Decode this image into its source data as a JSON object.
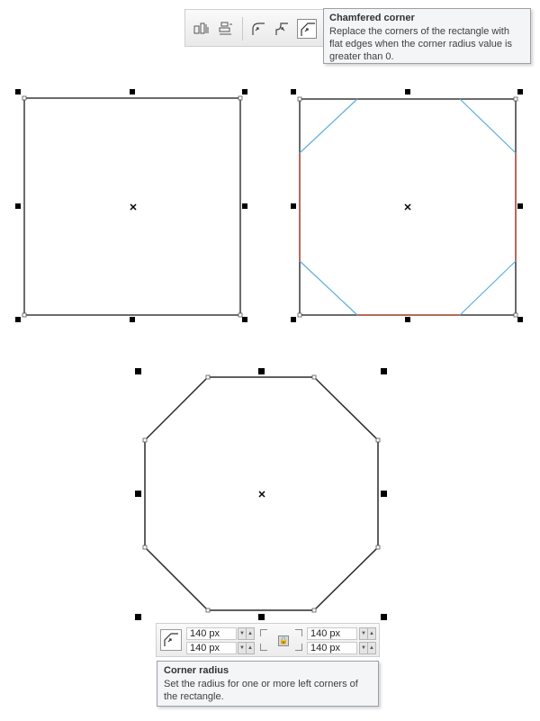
{
  "toolbar": {
    "buttons": [
      {
        "name": "corner-option-icon-1"
      },
      {
        "name": "corner-option-icon-2"
      },
      {
        "name": "round-corner-icon"
      },
      {
        "name": "scalloped-corner-icon"
      },
      {
        "name": "chamfered-corner-icon",
        "active": true
      }
    ]
  },
  "tooltip_chamfer": {
    "title": "Chamfered corner",
    "description": "Replace the corners of the rectangle with flat edges when the corner radius value is greater than 0."
  },
  "property_bar": {
    "top_left_radius": "140 px",
    "bottom_left_radius": "140 px",
    "top_right_radius": "140 px",
    "bottom_right_radius": "140 px",
    "spin_down": "▼",
    "spin_up": "▲",
    "lock_symbol": "🔒"
  },
  "tooltip_radius": {
    "title": "Corner radius",
    "description": "Set the radius for one or more left corners of the rectangle."
  },
  "colors": {
    "shape_outline": "#3a3a3a",
    "chamfer_edges": "#5aaee0",
    "highlight_edges": "#c0584a",
    "handles": "#000000"
  }
}
